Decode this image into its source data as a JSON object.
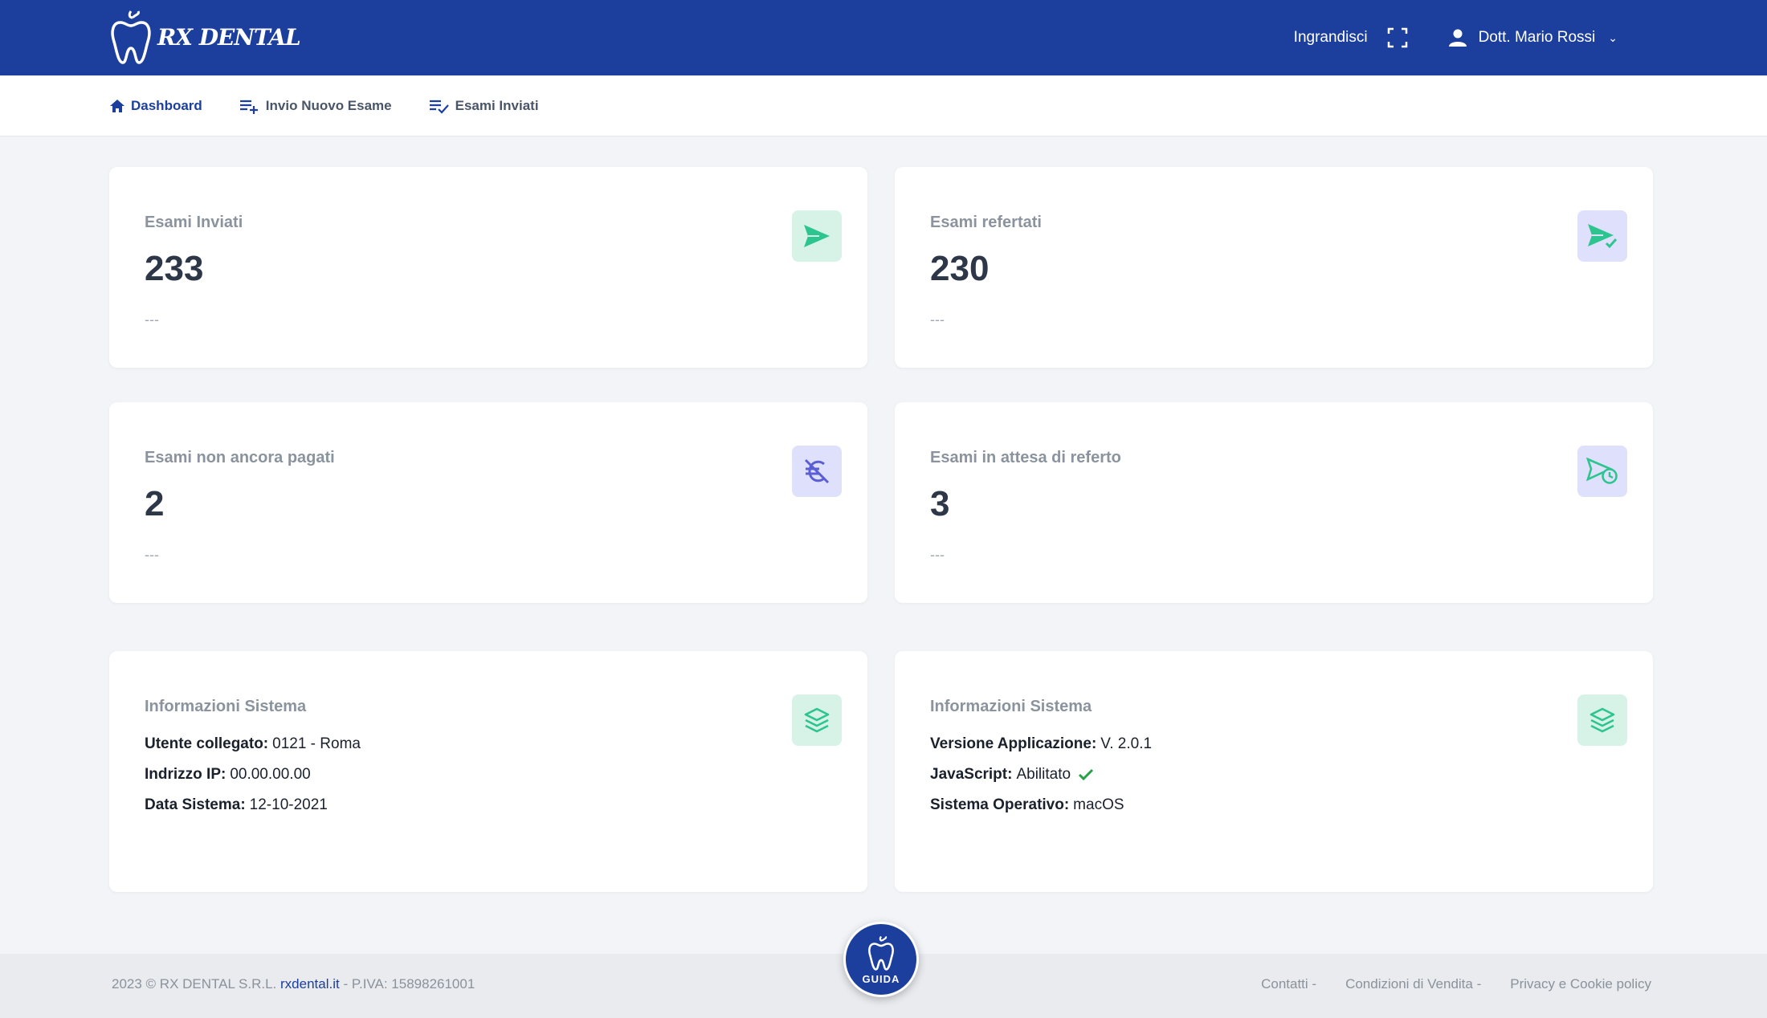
{
  "header": {
    "brand": "RX DENTAL",
    "zoom_label": "Ingrandisci",
    "user_name": "Dott. Mario Rossi"
  },
  "nav": {
    "items": [
      {
        "label": "Dashboard",
        "icon": "home-icon",
        "active": true
      },
      {
        "label": "Invio Nuovo Esame",
        "icon": "list-add-icon",
        "active": false
      },
      {
        "label": "Esami Inviati",
        "icon": "list-check-icon",
        "active": false
      }
    ]
  },
  "stats": {
    "sent": {
      "label": "Esami Inviati",
      "value": "233",
      "sub": "---",
      "icon": "send-icon"
    },
    "reported": {
      "label": "Esami refertati",
      "value": "230",
      "sub": "---",
      "icon": "send-check-icon"
    },
    "unpaid": {
      "label": "Esami non ancora pagati",
      "value": "2",
      "sub": "---",
      "icon": "euro-off-icon"
    },
    "pending": {
      "label": "Esami in attesa di referto",
      "value": "3",
      "sub": "---",
      "icon": "send-clock-icon"
    }
  },
  "system_left": {
    "title": "Informazioni Sistema",
    "lines": [
      {
        "key": "Utente collegato:",
        "value": "0121 - Roma"
      },
      {
        "key": "Indrizzo IP:",
        "value": "00.00.00.00"
      },
      {
        "key": "Data Sistema:",
        "value": "12-10-2021"
      }
    ]
  },
  "system_right": {
    "title": "Informazioni Sistema",
    "lines": [
      {
        "key": "Versione Applicazione:",
        "value": "V. 2.0.1"
      },
      {
        "key": "JavaScript:",
        "value": "Abilitato"
      },
      {
        "key": "Sistema Operativo:",
        "value": "macOS"
      }
    ]
  },
  "footer": {
    "copyright": "2023 © RX DENTAL S.R.L.",
    "site_link": "rxdental.it",
    "vat": "- P.IVA: 15898261001",
    "links": [
      "Contatti -",
      "Condizioni di Vendita -",
      "Privacy e Cookie policy"
    ]
  },
  "guide": {
    "label": "GUIDA"
  },
  "colors": {
    "primary": "#1c3f9e",
    "green_tint": "#d7f3e7",
    "green": "#2dc58f",
    "purple_tint": "#dfe0fb",
    "purple": "#5b5fd6",
    "check": "#25a244"
  }
}
